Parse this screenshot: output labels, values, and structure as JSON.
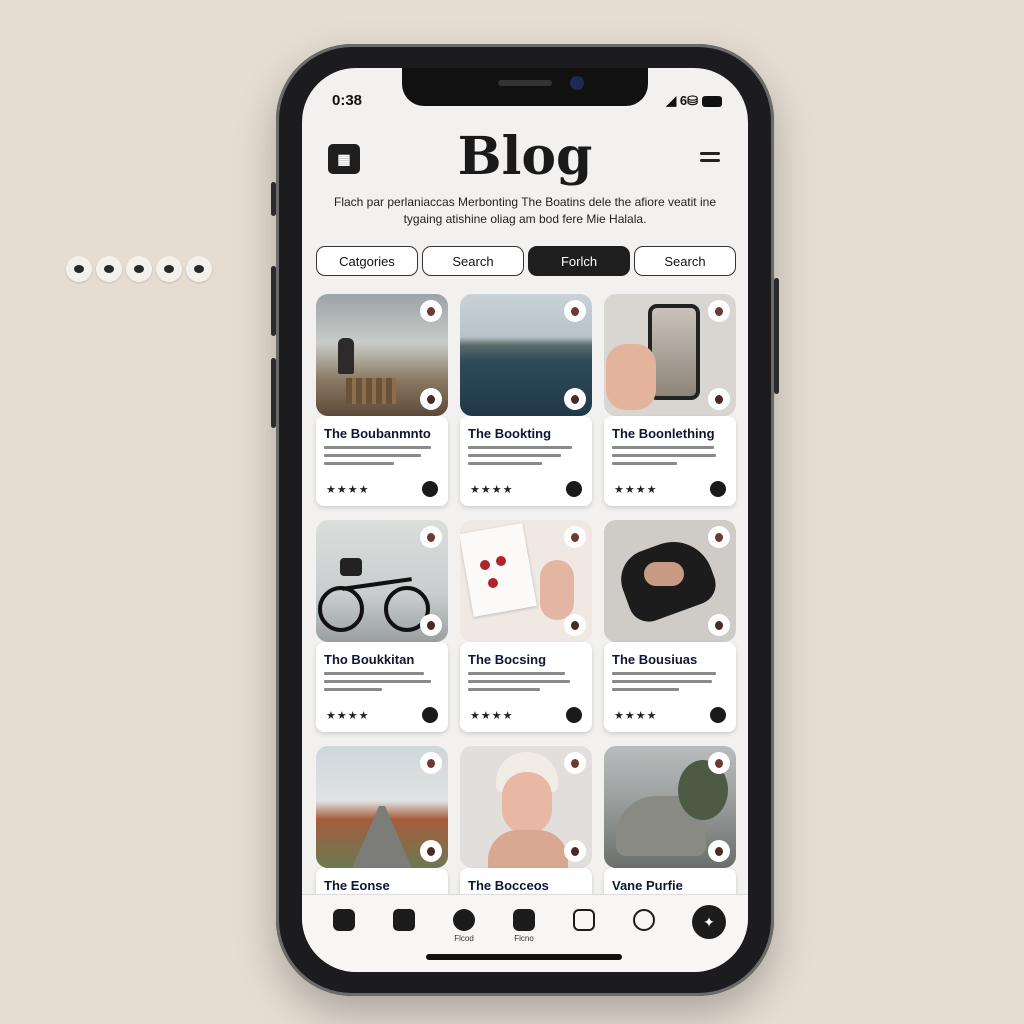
{
  "status": {
    "time": "0:38",
    "signal": "◢ 6⛁"
  },
  "header": {
    "menu_icon": "grid-icon",
    "menu_glyph": "▦",
    "title": "Blog",
    "subtitle": "Flach par perlaniaccas Merbonting The Boatins dele the afiore veatit ine tygaing atishine oliag am bod fere Mie Halala."
  },
  "tabs": [
    {
      "label": "Catgories",
      "active": false
    },
    {
      "label": "Search",
      "active": false
    },
    {
      "label": "Forlch",
      "active": true
    },
    {
      "label": "Search",
      "active": false
    }
  ],
  "cards": [
    {
      "title": "The Boubanmnto",
      "stars": "★★★★",
      "image": "greenhouse"
    },
    {
      "title": "The Bookting",
      "stars": "★★★★",
      "image": "lake"
    },
    {
      "title": "The Boonlething",
      "stars": "★★★★",
      "image": "phone-hand"
    },
    {
      "title": "Tho Boukkitan",
      "stars": "★★★★",
      "image": "bicycle"
    },
    {
      "title": "The Bocsing",
      "stars": "★★★★",
      "image": "strawberries"
    },
    {
      "title": "The Bousiuas",
      "stars": "★★★★",
      "image": "black-cloth"
    },
    {
      "title": "The Eonse",
      "stars": "",
      "image": "road"
    },
    {
      "title": "The Bocceos",
      "stars": "",
      "image": "portrait"
    },
    {
      "title": "Vane Purfie",
      "stars": "",
      "image": "rocks"
    }
  ],
  "nav": [
    {
      "label": "",
      "icon": "home-icon"
    },
    {
      "label": "",
      "icon": "chat-icon"
    },
    {
      "label": "Flcod",
      "icon": "feed-icon"
    },
    {
      "label": "Flcno",
      "icon": "bookmark-icon"
    },
    {
      "label": "",
      "icon": "music-icon"
    },
    {
      "label": "",
      "icon": "profile-icon"
    }
  ],
  "fab": {
    "icon": "compass-icon",
    "glyph": "✦"
  },
  "colors": {
    "page_bg": "#e5ddd2",
    "screen_bg": "#f2f1ef",
    "phone": "#1c1c1e",
    "title_text": "#0d1735"
  }
}
